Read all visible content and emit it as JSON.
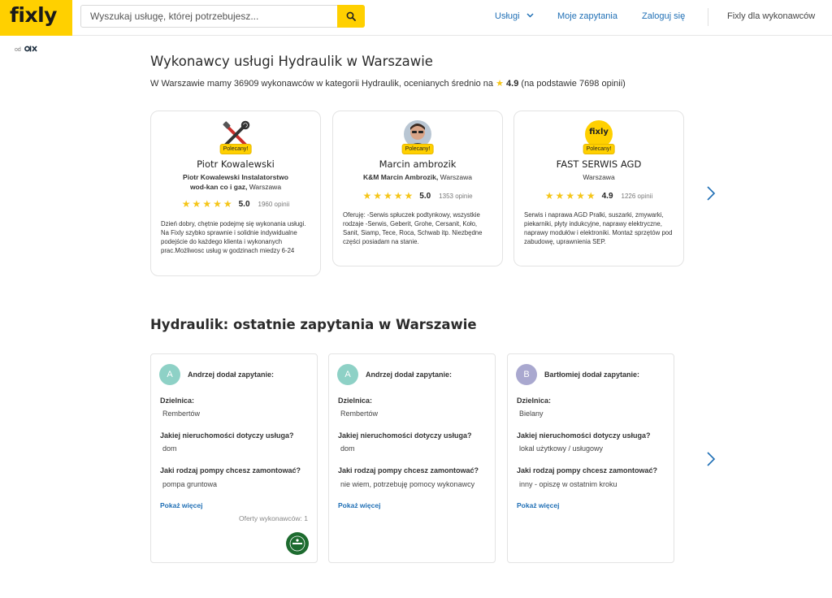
{
  "header": {
    "logo": "fixly",
    "search_placeholder": "Wyszukaj usługę, której potrzebujesz...",
    "nav": {
      "uslugi": "Usługi",
      "moje": "Moje zapytania",
      "zaloguj": "Zaloguj się",
      "fixly_wykonawcy": "Fixly dla wykonawców"
    },
    "od": "od",
    "olx": "OLX"
  },
  "contractors_section": {
    "title": "Wykonawcy usługi Hydraulik w Warszawie",
    "subtitle_pre": "W Warszawie mamy 36909 wykonawców w kategorii Hydraulik, ocenianych średnio na",
    "avg_rating": "4.9",
    "subtitle_post": "(na podstawie 7698 opinii)"
  },
  "contractors": [
    {
      "badge": "Polecany!",
      "name": "Piotr Kowalewski",
      "company_bold": "Piotr Kowalewski Instalatorstwo wod-kan co i gaz,",
      "city": "Warszawa",
      "rating": "5.0",
      "reviews": "1960 opinii",
      "description": "Dzień dobry, chętnie podejmę się wykonania usługi. Na Fixly szybko sprawnie i solidnie indywidualne podejście do każdego klienta i wykonanych prac.Możliwosc usług w godzinach miedzy 6-24"
    },
    {
      "badge": "Polecany!",
      "name": "Marcin ambrozik",
      "company_bold": "K&M Marcin Ambrozik,",
      "city": "Warszawa",
      "rating": "5.0",
      "reviews": "1353 opinie",
      "description": "Oferuję: -Serwis spłuczek podtynkowy, wszystkie rodzaje -Serwis, Geberit, Grohe, Cersanit, Koło, Sanit, Siamp, Tece, Roca, Schwab itp. Niezbędne części posiadam na stanie."
    },
    {
      "badge": "Polecany!",
      "name": "FAST SERWIS AGD",
      "company_bold": "",
      "city": "Warszawa",
      "rating": "4.9",
      "reviews": "1226 opinii",
      "avatar_text": "fixly",
      "description": "Serwis i naprawa AGD Pralki, suszarki, zmywarki, piekarniki, płyty indukcyjne, naprawy elektryczne, naprawy modułów i elektroniki. Montaż sprzętów pod zabudowę, uprawnienia SEP."
    }
  ],
  "requests_section": {
    "title": "Hydraulik: ostatnie zapytania w Warszawie"
  },
  "requests": [
    {
      "initial": "A",
      "avatar_color": "#8ed1c6",
      "header": "Andrzej dodał zapytanie:",
      "q1": "Dzielnica:",
      "a1": "Rembertów",
      "q2": "Jakiej nieruchomości dotyczy usługa?",
      "a2": "dom",
      "q3": "Jaki rodzaj pompy chcesz zamontować?",
      "a3": "pompa gruntowa",
      "more": "Pokaż więcej",
      "offers": "Oferty wykonawców: 1"
    },
    {
      "initial": "A",
      "avatar_color": "#8ed1c6",
      "header": "Andrzej dodał zapytanie:",
      "q1": "Dzielnica:",
      "a1": "Rembertów",
      "q2": "Jakiej nieruchomości dotyczy usługa?",
      "a2": "dom",
      "q3": "Jaki rodzaj pompy chcesz zamontować?",
      "a3": "nie wiem, potrzebuję pomocy wykonawcy",
      "more": "Pokaż więcej"
    },
    {
      "initial": "B",
      "avatar_color": "#a9a8cf",
      "header": "Bartłomiej dodał zapytanie:",
      "q1": "Dzielnica:",
      "a1": "Bielany",
      "q2": "Jakiej nieruchomości dotyczy usługa?",
      "a2": "lokal użytkowy / usługowy",
      "q3": "Jaki rodzaj pompy chcesz zamontować?",
      "a3": "inny - opiszę w ostatnim kroku",
      "more": "Pokaż więcej"
    }
  ],
  "colors": {
    "brand_yellow": "#ffd000",
    "link_blue": "#1f6fb5",
    "star": "#f5c518"
  }
}
